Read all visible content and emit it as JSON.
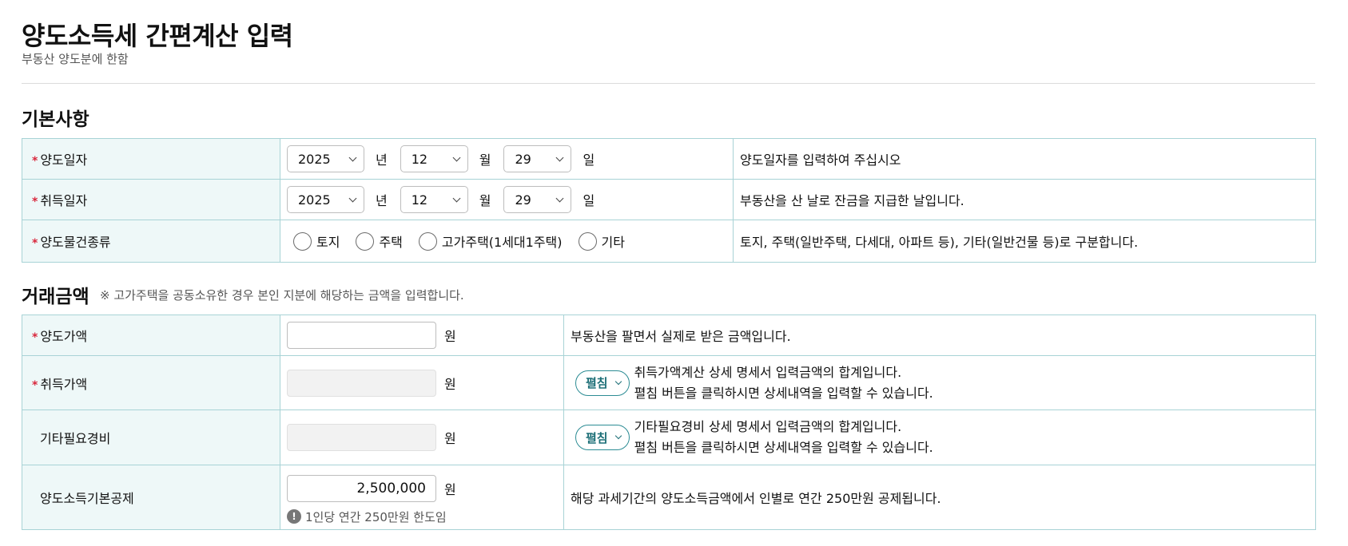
{
  "header": {
    "title": "양도소득세 간편계산 입력",
    "subtitle": "부동산 양도분에 한함"
  },
  "basic": {
    "title": "기본사항",
    "required_mark": "*",
    "transfer_date": {
      "label": "양도일자",
      "year": "2025",
      "year_unit": "년",
      "month": "12",
      "month_unit": "월",
      "day": "29",
      "day_unit": "일",
      "description": "양도일자를 입력하여 주십시오"
    },
    "acquisition_date": {
      "label": "취득일자",
      "year": "2025",
      "year_unit": "년",
      "month": "12",
      "month_unit": "월",
      "day": "29",
      "day_unit": "일",
      "description": "부동산을 산 날로 잔금을 지급한 날입니다."
    },
    "property_type": {
      "label": "양도물건종류",
      "options": [
        "토지",
        "주택",
        "고가주택(1세대1주택)",
        "기타"
      ],
      "description": "토지, 주택(일반주택, 다세대, 아파트 등), 기타(일반건물 등)로 구분합니다."
    }
  },
  "amount": {
    "title": "거래금액",
    "note": "※ 고가주택을 공동소유한 경우 본인 지분에 해당하는 금액을 입력합니다.",
    "currency_unit": "원",
    "expand_label": "펼침",
    "transfer_price": {
      "label": "양도가액",
      "value": "",
      "description": "부동산을 팔면서 실제로 받은 금액입니다."
    },
    "acquisition_price": {
      "label": "취득가액",
      "value": "",
      "description_line1": "취득가액계산 상세 명세서 입력금액의 합계입니다.",
      "description_line2": "펼침 버튼을 클릭하시면 상세내역을 입력할 수 있습니다."
    },
    "other_expenses": {
      "label": "기타필요경비",
      "value": "",
      "description_line1": "기타필요경비 상세 명세서 입력금액의 합계입니다.",
      "description_line2": "펼침 버튼을 클릭하시면 상세내역을 입력할 수 있습니다."
    },
    "basic_deduction": {
      "label": "양도소득기본공제",
      "value": "2,500,000",
      "hint_icon": "!",
      "hint": "1인당 연간 250만원 한도임",
      "description": "해당 과세기간의 양도소득금액에서 인별로 연간 250만원 공제됩니다."
    }
  }
}
